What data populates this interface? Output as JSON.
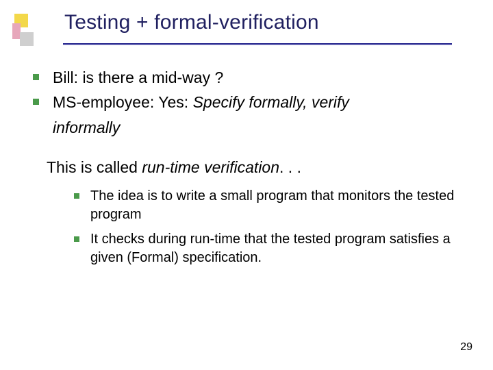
{
  "title": "Testing + formal-verification",
  "bullets1": [
    {
      "text": "Bill: is there a mid-way ?"
    },
    {
      "prefix": "MS-employee: Yes: ",
      "ital": "Specify formally, verify"
    }
  ],
  "cont_ital": "informally",
  "mid_prefix": "This is called ",
  "mid_ital": "run-time verification",
  "mid_suffix": ". . .",
  "bullets2": [
    {
      "text": "The idea is to write a small program that monitors the tested program"
    },
    {
      "text": "It checks during run-time that the tested program satisfies a given (Formal) specification."
    }
  ],
  "page_number": "29"
}
